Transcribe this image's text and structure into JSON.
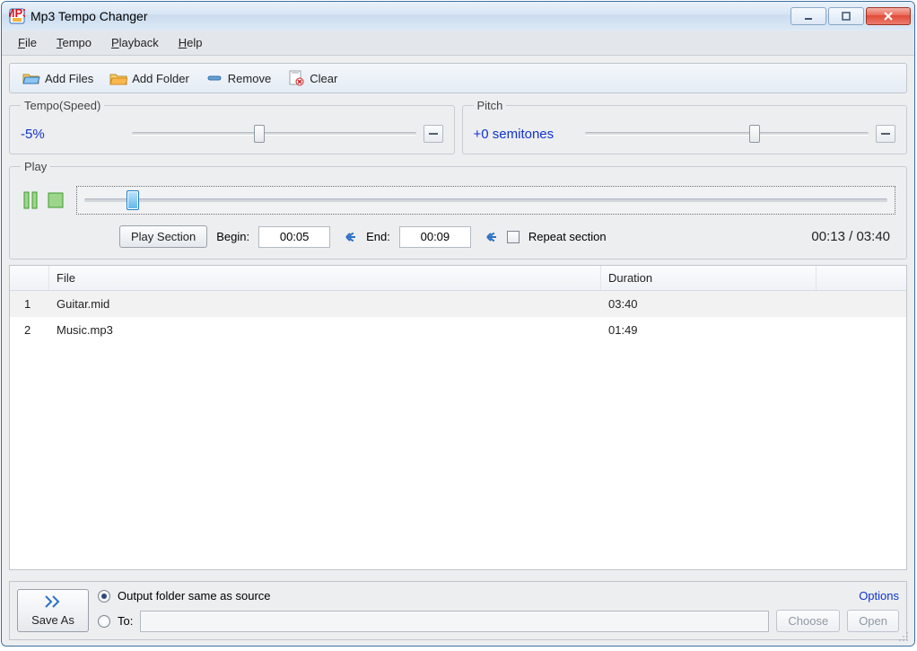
{
  "window": {
    "title": "Mp3 Tempo Changer"
  },
  "menu": {
    "file": "File",
    "tempo": "Tempo",
    "playback": "Playback",
    "help": "Help"
  },
  "toolbar": {
    "add_files": "Add Files",
    "add_folder": "Add Folder",
    "remove": "Remove",
    "clear": "Clear"
  },
  "tempo": {
    "legend": "Tempo(Speed)",
    "value": "-5%",
    "slider_percent": 45
  },
  "pitch": {
    "legend": "Pitch",
    "value": "+0 semitones",
    "slider_percent": 60
  },
  "play": {
    "legend": "Play",
    "play_section": "Play Section",
    "begin_label": "Begin:",
    "begin_value": "00:05",
    "end_label": "End:",
    "end_value": "00:09",
    "repeat_label": "Repeat section",
    "time_display": "00:13 / 03:40",
    "timeline_percent": 6
  },
  "filelist": {
    "headers": {
      "file": "File",
      "duration": "Duration"
    },
    "rows": [
      {
        "index": "1",
        "file": "Guitar.mid",
        "duration": "03:40",
        "selected": true
      },
      {
        "index": "2",
        "file": "Music.mp3",
        "duration": "01:49",
        "selected": false
      }
    ]
  },
  "output": {
    "same_as_source": "Output folder same as source",
    "to_label": "To:",
    "choose": "Choose",
    "open": "Open",
    "options": "Options",
    "save_as": "Save As"
  }
}
